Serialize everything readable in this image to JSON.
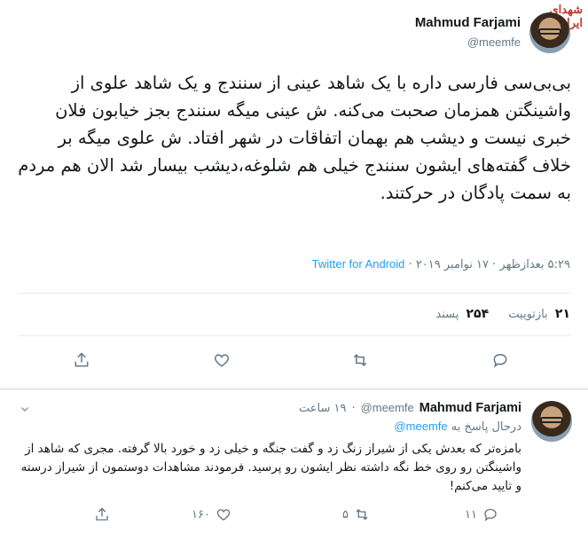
{
  "watermark": "شهدای ایران",
  "main_tweet": {
    "author_name": "Mahmud Farjami",
    "author_handle": "@meemfe",
    "text": "بی‌بی‌سی فارسی داره با یک شاهد عینی از سنندج و یک شاهد علوی از واشینگتن همزمان صحبت می‌کنه. ش عینی میگه سنندج بجز خیابون فلان خبری نیست و دیشب هم بهمان اتفاقات در شهر افتاد. ش علوی میگه بر خلاف گفته‌های ایشون سنندج خیلی هم شلوغه،دیشب بیسار شد الان هم مردم به سمت پادگان در حرکتند.",
    "time": "۵:۲۹ بعدازظهر",
    "date": "۱۷ نوامبر ۲۰۱۹",
    "separator": "·",
    "client": "Twitter for Android",
    "retweets_count": "۲۱",
    "retweets_label": "بازتوییت",
    "likes_count": "۲۵۴",
    "likes_label": "پسند"
  },
  "reply": {
    "author_name": "Mahmud Farjami",
    "author_handle": "@meemfe",
    "separator": "·",
    "age": "۱۹ ساعت",
    "reply_to_label": "درحال پاسخ به",
    "reply_to_handle": "@meemfe",
    "text": "بامزه‌تر که بعدش یکی از شیراز زنگ زد و گفت جنگه و خیلی زد و خورد بالا گرفته. مجری که شاهد از واشینگتن رو روی خط نگه داشته نظر ایشون رو پرسید. فرمودند مشاهدات دوستمون از شیراز درسته و تایید می‌کنم!",
    "replies_count": "۱۱",
    "retweets_count": "۵",
    "likes_count": "۱۶۰"
  },
  "icons": {
    "reply": "reply-icon",
    "retweet": "retweet-icon",
    "like": "heart-icon",
    "share": "share-icon",
    "caret": "chevron-down-icon"
  },
  "colors": {
    "link": "#1da1f2",
    "muted": "#657786",
    "text": "#14171a",
    "divider": "#e6ecf0"
  }
}
